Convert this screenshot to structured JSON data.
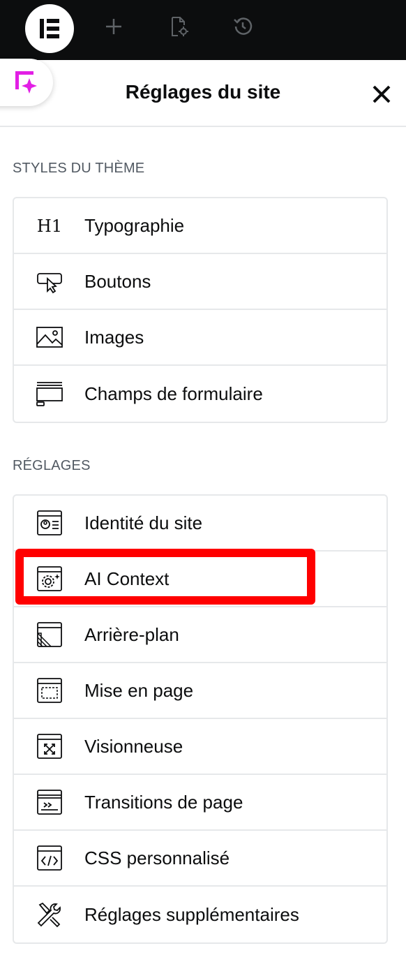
{
  "topbar": {
    "logo_icon": "elementor-logo-icon",
    "add_icon": "plus-icon",
    "page_settings_icon": "page-settings-icon",
    "history_icon": "history-icon"
  },
  "panel": {
    "title": "Réglages du site",
    "close_icon": "close-icon",
    "ai_icon": "ai-sparkle-icon"
  },
  "theme_styles": {
    "section_title": "STYLES DU THÈME",
    "items": [
      {
        "label": "Typographie",
        "icon": "heading-h1-icon"
      },
      {
        "label": "Boutons",
        "icon": "button-pointer-icon"
      },
      {
        "label": "Images",
        "icon": "image-icon"
      },
      {
        "label": "Champs de formulaire",
        "icon": "form-field-icon"
      }
    ]
  },
  "settings": {
    "section_title": "RÉGLAGES",
    "items": [
      {
        "label": "Identité du site",
        "icon": "site-identity-icon"
      },
      {
        "label": "AI Context",
        "icon": "ai-context-gear-icon"
      },
      {
        "label": "Arrière-plan",
        "icon": "background-icon"
      },
      {
        "label": "Mise en page",
        "icon": "layout-icon"
      },
      {
        "label": "Visionneuse",
        "icon": "lightbox-icon"
      },
      {
        "label": "Transitions de page",
        "icon": "page-transitions-icon"
      },
      {
        "label": "CSS personnalisé",
        "icon": "custom-css-icon"
      },
      {
        "label": "Réglages supplémentaires",
        "icon": "tools-icon"
      }
    ]
  },
  "colors": {
    "topbar_bg": "#0c0d0e",
    "highlight": "#ff0000",
    "ai_accent": "#e21fe5"
  }
}
